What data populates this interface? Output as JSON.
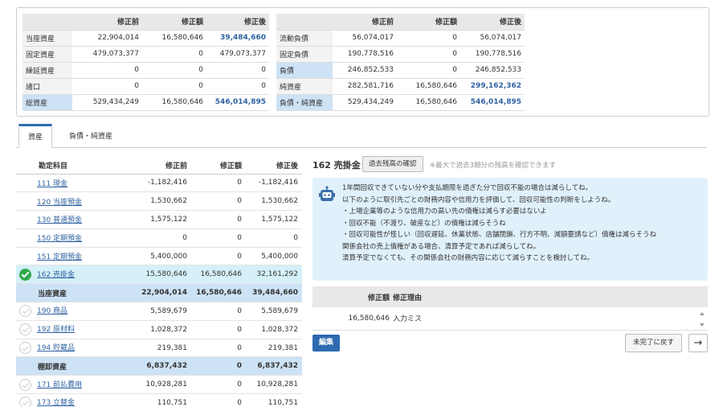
{
  "summary": {
    "left_headers": [
      "",
      "修正前",
      "修正額",
      "修正後"
    ],
    "left_rows": [
      {
        "label": "当座資産",
        "before": "22,904,014",
        "amount": "16,580,646",
        "after": "39,484,660",
        "after_blue": true
      },
      {
        "label": "固定資産",
        "before": "479,073,377",
        "amount": "0",
        "after": "479,073,377",
        "after_blue": false
      },
      {
        "label": "繰延資産",
        "before": "0",
        "amount": "0",
        "after": "0",
        "after_blue": false
      },
      {
        "label": "諸口",
        "before": "0",
        "amount": "0",
        "after": "0",
        "after_blue": false
      },
      {
        "label": "総資産",
        "before": "529,434,249",
        "amount": "16,580,646",
        "after": "546,014,895",
        "after_blue": true
      }
    ],
    "right_headers": [
      "",
      "修正前",
      "修正額",
      "修正後"
    ],
    "right_rows": [
      {
        "label": "流動負債",
        "before": "56,074,017",
        "amount": "0",
        "after": "56,074,017",
        "after_blue": false
      },
      {
        "label": "固定負債",
        "before": "190,778,516",
        "amount": "0",
        "after": "190,778,516",
        "after_blue": false
      },
      {
        "label": "負債",
        "before": "246,852,533",
        "amount": "0",
        "after": "246,852,533",
        "after_blue": false
      },
      {
        "label": "純資産",
        "before": "282,581,716",
        "amount": "16,580,646",
        "after": "299,162,362",
        "after_blue": true
      },
      {
        "label": "負債・純資産",
        "before": "529,434,249",
        "amount": "16,580,646",
        "after": "546,014,895",
        "after_blue": true
      }
    ]
  },
  "tabs": {
    "assets": "資産",
    "liabilities": "負債・純資産"
  },
  "accounts": {
    "headers": [
      "勘定科目",
      "修正前",
      "修正額",
      "修正後"
    ],
    "rows": [
      {
        "type": "item",
        "check": "none",
        "name": "111 現金",
        "before": "-1,182,416",
        "amount": "0",
        "after": "-1,182,416"
      },
      {
        "type": "item",
        "check": "none",
        "name": "120 当座預金",
        "before": "1,530,662",
        "amount": "0",
        "after": "1,530,662"
      },
      {
        "type": "item",
        "check": "none",
        "name": "130 普通預金",
        "before": "1,575,122",
        "amount": "0",
        "after": "1,575,122"
      },
      {
        "type": "item",
        "check": "none",
        "name": "150 定期預金",
        "before": "0",
        "amount": "0",
        "after": "0"
      },
      {
        "type": "item",
        "check": "none",
        "name": "151 定期預金",
        "before": "5,400,000",
        "amount": "0",
        "after": "5,400,000"
      },
      {
        "type": "selected",
        "check": "on",
        "name": "162 売掛金",
        "before": "15,580,646",
        "amount": "16,580,646",
        "after": "32,161,292"
      },
      {
        "type": "subtotal",
        "check": "none",
        "name": "当座資産",
        "before": "22,904,014",
        "amount": "16,580,646",
        "after": "39,484,660"
      },
      {
        "type": "item",
        "check": "off",
        "name": "190 商品",
        "before": "5,589,679",
        "amount": "0",
        "after": "5,589,679"
      },
      {
        "type": "item",
        "check": "off",
        "name": "192 原材料",
        "before": "1,028,372",
        "amount": "0",
        "after": "1,028,372"
      },
      {
        "type": "item",
        "check": "off",
        "name": "194 貯蔵品",
        "before": "219,381",
        "amount": "0",
        "after": "219,381"
      },
      {
        "type": "subtotal",
        "check": "none",
        "name": "棚卸資産",
        "before": "6,837,432",
        "amount": "0",
        "after": "6,837,432"
      },
      {
        "type": "item",
        "check": "off",
        "name": "171 前払費用",
        "before": "10,928,281",
        "amount": "0",
        "after": "10,928,281"
      },
      {
        "type": "item",
        "check": "off",
        "name": "173 立替金",
        "before": "110,751",
        "amount": "0",
        "after": "110,751"
      }
    ]
  },
  "detail": {
    "title": "162 売掛金",
    "confirm_button": "過去残高の確認",
    "note": "※最大で過去3期分の残高を確認できます",
    "advice_lines": [
      "1年間回収できていない分や支払期限を過ぎた分で回収不能の場合は減らしてね。",
      "以下のように取引先ごとの財務内容や信用力を評価して、回収可能性の判断をしようね。",
      "・上場企業等のような信用力の高い先の債権は減らす必要はないよ",
      "・回収不能（不渡り、破産など）の債権は減らそうね",
      "・回収可能性が怪しい（回収遅延、休業状態、店舗閉鎖、行方不明、減額要請など）債権は減らそうね",
      "関係会社の売上債権がある場合、清算予定であれば減らしてね。",
      "清算予定でなくても、その関係会社の財務内容に応じて減らすことを検討してね。"
    ],
    "revision_headers": {
      "amount": "修正額",
      "reason": "修正理由"
    },
    "revision_rows": [
      {
        "amount": "16,580,646",
        "reason": "入力ミス"
      }
    ],
    "edit_button": "編集",
    "back_button": "未完了に戻す",
    "next_button": "→"
  }
}
